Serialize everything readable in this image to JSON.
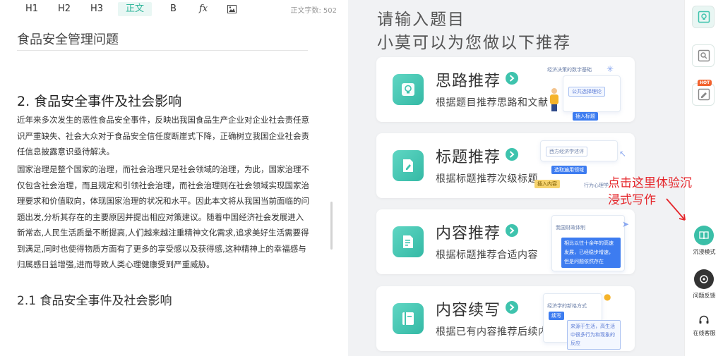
{
  "toolbar": {
    "h1": "H1",
    "h2": "H2",
    "h3": "H3",
    "body": "正文",
    "bold": "B",
    "formula": "fx",
    "image_icon": "image-icon",
    "word_count_label": "正文字数:",
    "word_count_value": "502"
  },
  "document": {
    "title": "食品安全管理问题",
    "heading2": "2. 食品安全事件及社会影响",
    "paragraph1": "近年来多次发生的恶性食品安全事件，反映出我国食品生产企业对企业社会责任意识严重缺失、社会大众对于食品安全信任度断崖式下降，正确树立我国企业社会责任信息披露意识亟待解决。",
    "paragraph2": "国家治理是整个国家的治理，而社会治理只是社会领域的治理，为此，国家治理不仅包含社会治理，而且规定和引领社会治理，而社会治理则在社会领域实现国家治理要求和价值取向，体现国家治理的状况和水平。因此本文将从我国当前面临的问题出发,分析其存在的主要原因并提出相应对策建议。随着中国经济社会发展进入新常态,人民生活质量不断提高,人们越来越注重精神文化需求,追求美好生活需要得到满足,同时也使得物质方面有了更多的享受感以及获得感,这种精神上的幸福感与归属感日益增强,进而导致人类心理健康受到严重威胁。",
    "heading3": "2.1 食品安全事件及社会影响"
  },
  "panel": {
    "prompt_line1": "请输入题目",
    "prompt_line2": "小莫可以为您做以下推荐",
    "cards": [
      {
        "title": "思路推荐",
        "desc": "根据题目推荐思路和文献",
        "icon": "lightbulb-icon",
        "illu": [
          "经济决策的数字基础",
          "公共选择理论",
          "插入标题"
        ]
      },
      {
        "title": "标题推荐",
        "desc": "根据标题推荐次级标题",
        "icon": "edit-doc-icon",
        "illu": [
          "西方经济学述评",
          "选取遍用领域",
          "插入内容",
          "行为心理学"
        ]
      },
      {
        "title": "内容推荐",
        "desc": "根据标题推荐合适内容",
        "icon": "content-doc-icon",
        "illu": [
          "我国财政体制",
          "相比以往十余年的高速发展，已经稳步增速，但是问题依然存在"
        ]
      },
      {
        "title": "内容续写",
        "desc": "根据已有内容推荐后续内容",
        "icon": "book-icon",
        "illu": [
          "经济学的新格方式",
          "续写",
          "来源于生活，高生活中很多行为和现象的反应"
        ]
      }
    ]
  },
  "sidebar": {
    "buttons": [
      "recommend-icon",
      "search-doc-icon",
      "hot-doc-icon"
    ],
    "hot_badge": "HOT",
    "immersive_label": "沉浸模式",
    "feedback_label": "问题反馈",
    "service_label": "在线客服"
  },
  "annotation": {
    "line1": "点击这里体验沉",
    "line2": "浸式写作"
  },
  "colors": {
    "accent": "#3ec3ad",
    "annotation": "#e5252a",
    "panel_bg": "#f1f2f4"
  }
}
